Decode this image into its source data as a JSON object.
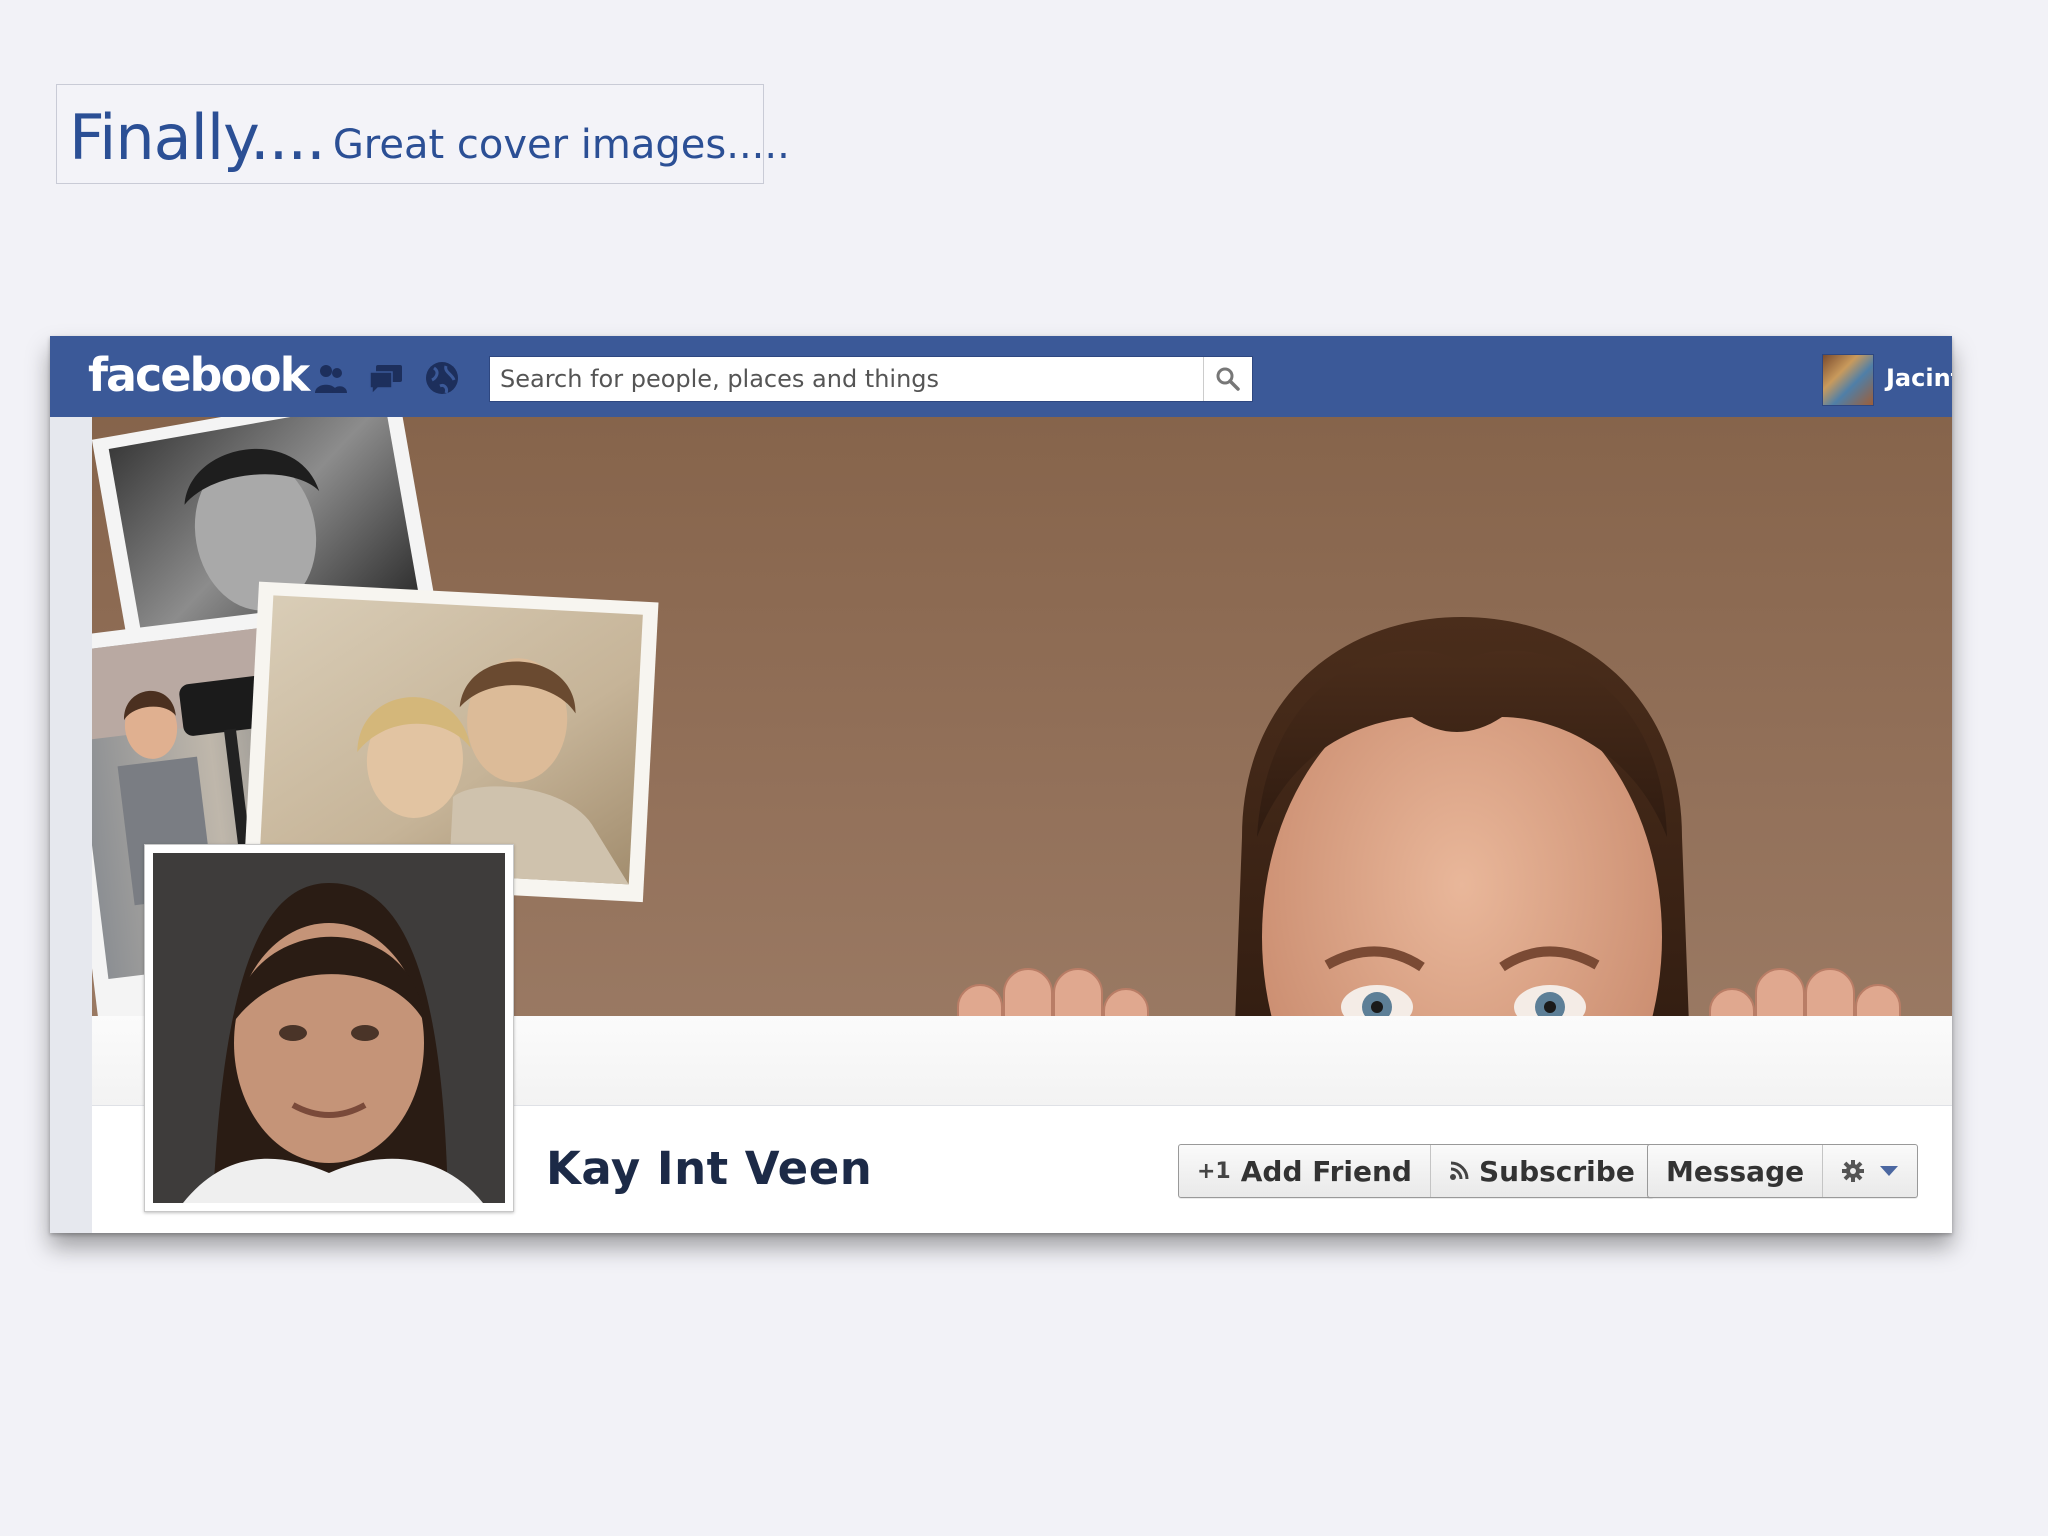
{
  "slide": {
    "title_big": "Finally....",
    "title_small": "Great cover images....."
  },
  "facebook": {
    "logo": "facebook",
    "search": {
      "placeholder": "Search for people, places and things"
    },
    "user": {
      "name": "Jacint"
    },
    "jewels": [
      "friend-requests-icon",
      "messages-icon",
      "notifications-globe-icon"
    ]
  },
  "profile": {
    "name": "Kay Int Veen",
    "buttons": {
      "add_friend": "Add Friend",
      "subscribe": "Subscribe",
      "message": "Message"
    }
  },
  "colors": {
    "fb_blue": "#3b5998",
    "cover_brown": "#8b6a52",
    "slide_title": "#2b4f95"
  }
}
